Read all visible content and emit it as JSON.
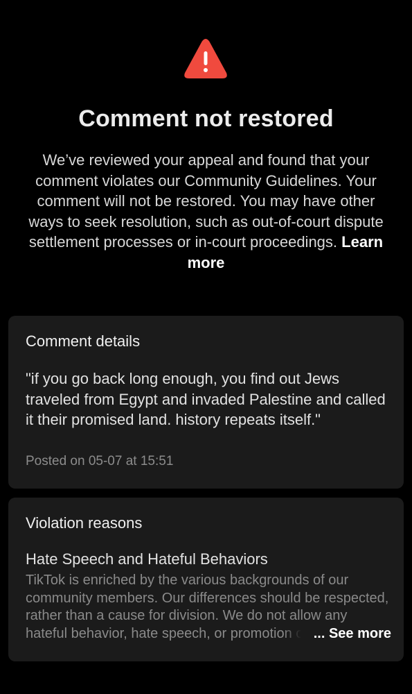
{
  "header": {
    "icon": "warning-triangle-icon",
    "icon_color": "#f04a3e",
    "title": "Comment not restored",
    "description": "We’ve reviewed your appeal and found that your comment violates our Community Guidelines. Your comment will not be restored. You may have other ways to seek resolution, such as out-of-court dispute settlement processes or in-court proceedings.",
    "learn_more": "Learn more"
  },
  "comment_details": {
    "title": "Comment details",
    "comment": "\"if you go back long enough, you find out Jews traveled from Egypt and invaded Palestine and called it their promised land. history repeats itself.\"",
    "posted": "Posted on 05-07 at 15:51"
  },
  "violation": {
    "title": "Violation reasons",
    "reason_title": "Hate Speech and Hateful Behaviors",
    "reason_description": "TikTok is enriched by the various backgrounds of our community members. Our differences should be respected, rather than a cause for division. We do not allow any hateful behavior, hate speech, or promotion of hateful ideologies.",
    "see_more": "... See more"
  }
}
